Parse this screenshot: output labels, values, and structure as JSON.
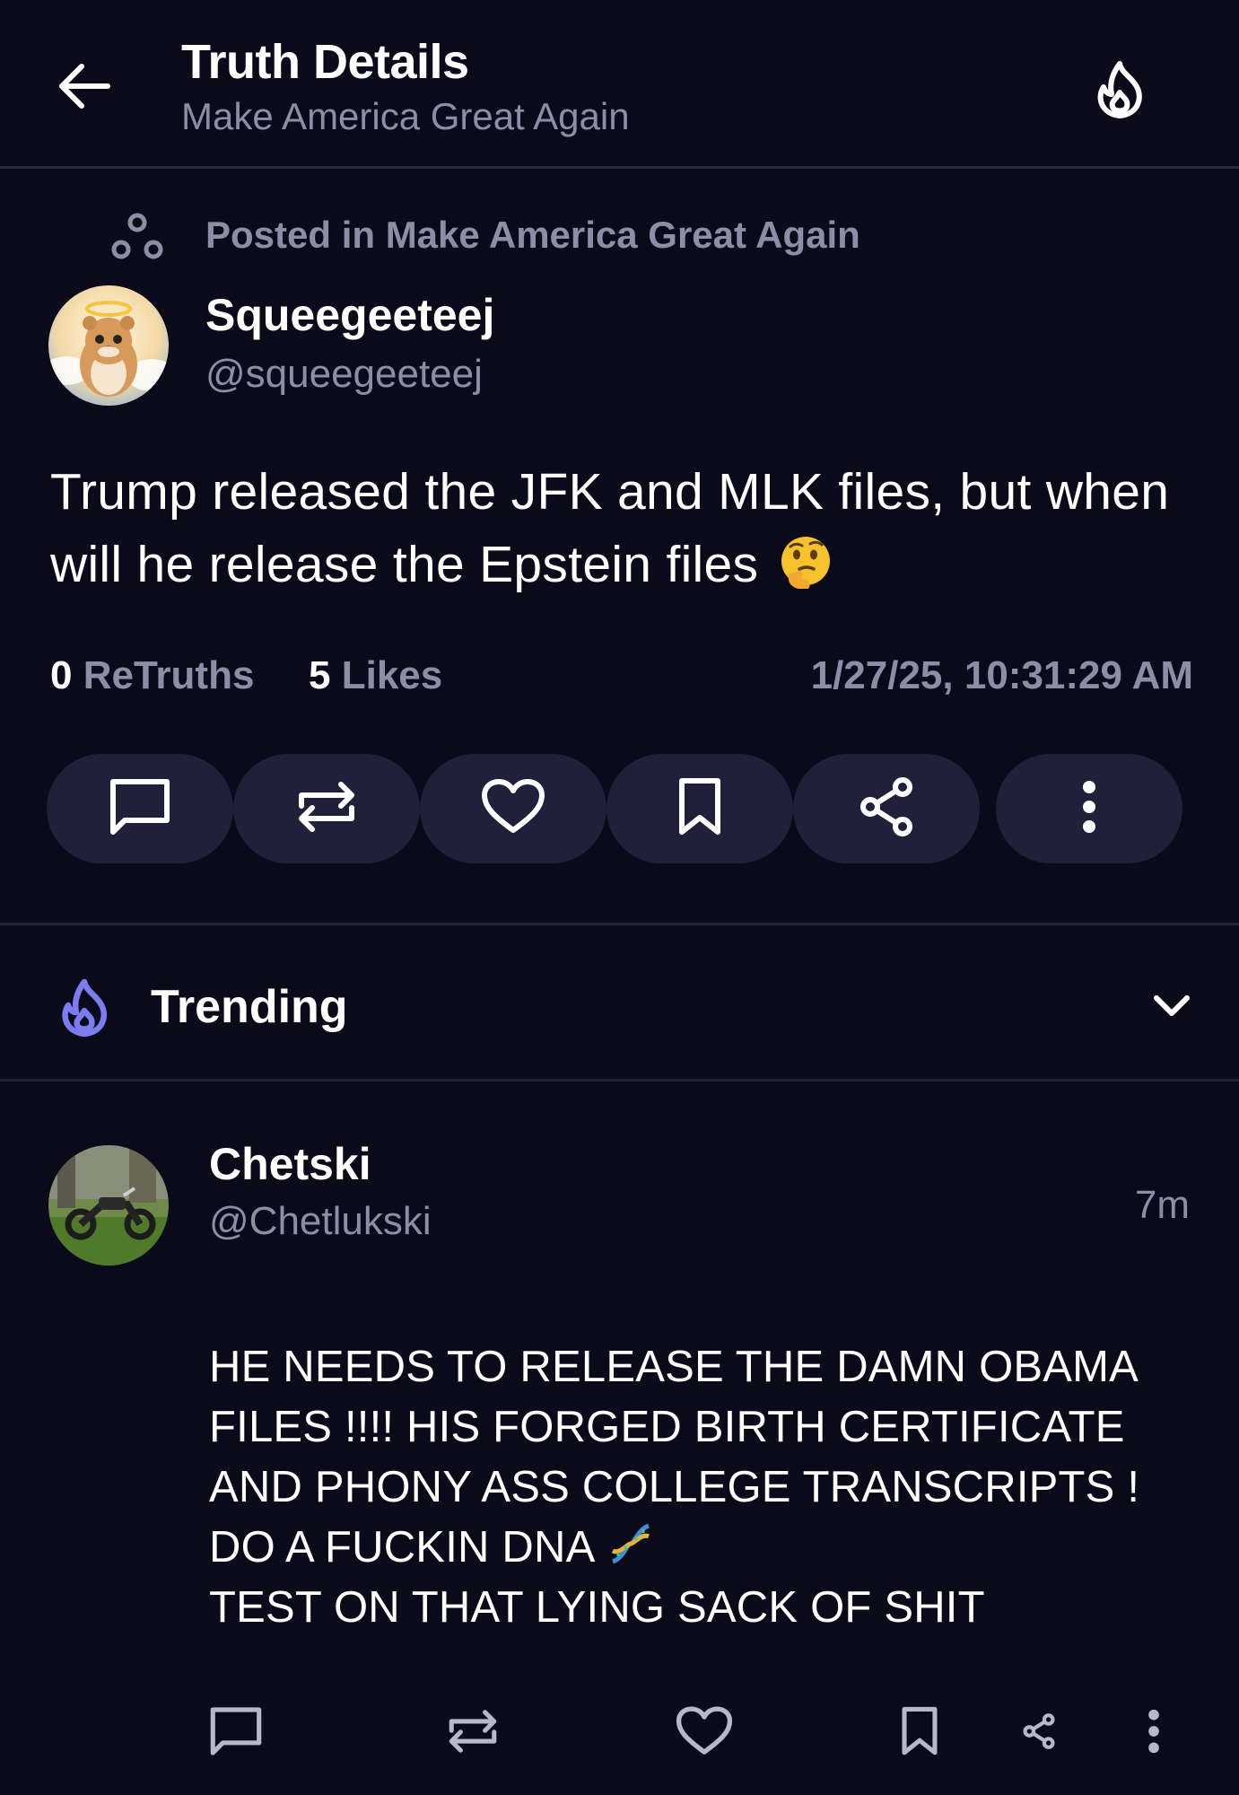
{
  "header": {
    "title": "Truth Details",
    "subtitle": "Make America Great Again"
  },
  "post": {
    "posted_in": "Posted in Make America Great Again",
    "author_name": "Squeegeeteej",
    "author_handle": "@squeegeeteej",
    "body": "Trump released the JFK and MLK files, but when will he release the Epstein files",
    "body_emoji": "thinking-face-emoji",
    "retruths_count": "0",
    "retruths_label": "ReTruths",
    "likes_count": "5",
    "likes_label": "Likes",
    "timestamp": "1/27/25, 10:31:29 AM",
    "actions": [
      "reply",
      "retruth",
      "like",
      "bookmark",
      "share",
      "more"
    ]
  },
  "trending": {
    "label": "Trending"
  },
  "reply": {
    "author_name": "Chetski",
    "author_handle": "@Chetlukski",
    "time_ago": "7m",
    "body": "HE NEEDS TO RELEASE THE DAMN OBAMA FILES !!!! HIS FORGED BIRTH CERTIFICATE AND PHONY ASS COLLEGE TRANSCRIPTS ! DO A FUCKIN DNA",
    "body_emoji": "dna-emoji",
    "body_tail": "TEST ON THAT LYING SACK OF SHIT",
    "actions": [
      "reply",
      "retruth",
      "like",
      "bookmark",
      "share",
      "more"
    ]
  },
  "colors": {
    "background": "#0b0a1a",
    "pill": "#20203a",
    "muted_text": "#8f8da6",
    "accent": "#7b7cf0"
  }
}
